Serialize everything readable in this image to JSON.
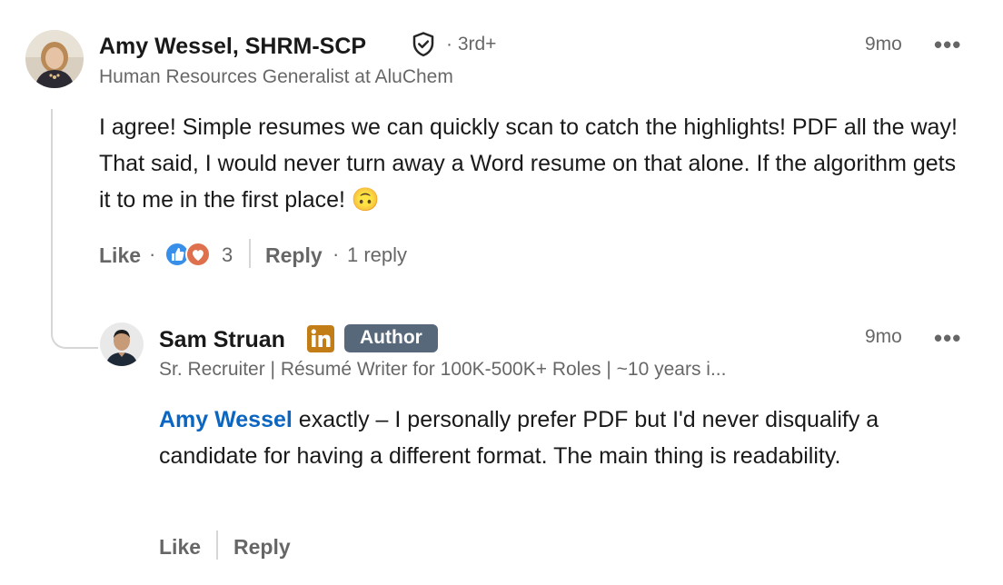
{
  "comment": {
    "author": {
      "name": "Amy Wessel, SHRM-SCP",
      "degree": "3rd+",
      "headline": "Human Resources Generalist at AluChem",
      "verified_icon": "shield-check-icon"
    },
    "time": "9mo",
    "text": "I agree! Simple resumes we can quickly scan to catch the highlights! PDF all the way! That said, I would never turn away a Word resume on that alone. If the algorithm gets it to me in the first place! 🙃",
    "actions": {
      "like": "Like",
      "reaction_count": "3",
      "reply": "Reply",
      "reply_count": "1 reply"
    }
  },
  "reply": {
    "author": {
      "name": "Sam Struan",
      "badge": "Author",
      "headline": "Sr. Recruiter | Résumé Writer for 100K-500K+ Roles | ~10 years i...",
      "premium_icon": "linkedin-in-icon"
    },
    "time": "9mo",
    "mention": "Amy Wessel",
    "text": " exactly – I personally prefer PDF but I'd never disqualify a candidate for having a different format. The main thing is readability.",
    "actions": {
      "like": "Like",
      "reply": "Reply"
    }
  },
  "colors": {
    "mention": "#0a66c2",
    "badge_bg": "#56687a",
    "linkedin_gold": "#c37d16",
    "like_blue": "#378fe9",
    "love_red": "#df704d"
  }
}
